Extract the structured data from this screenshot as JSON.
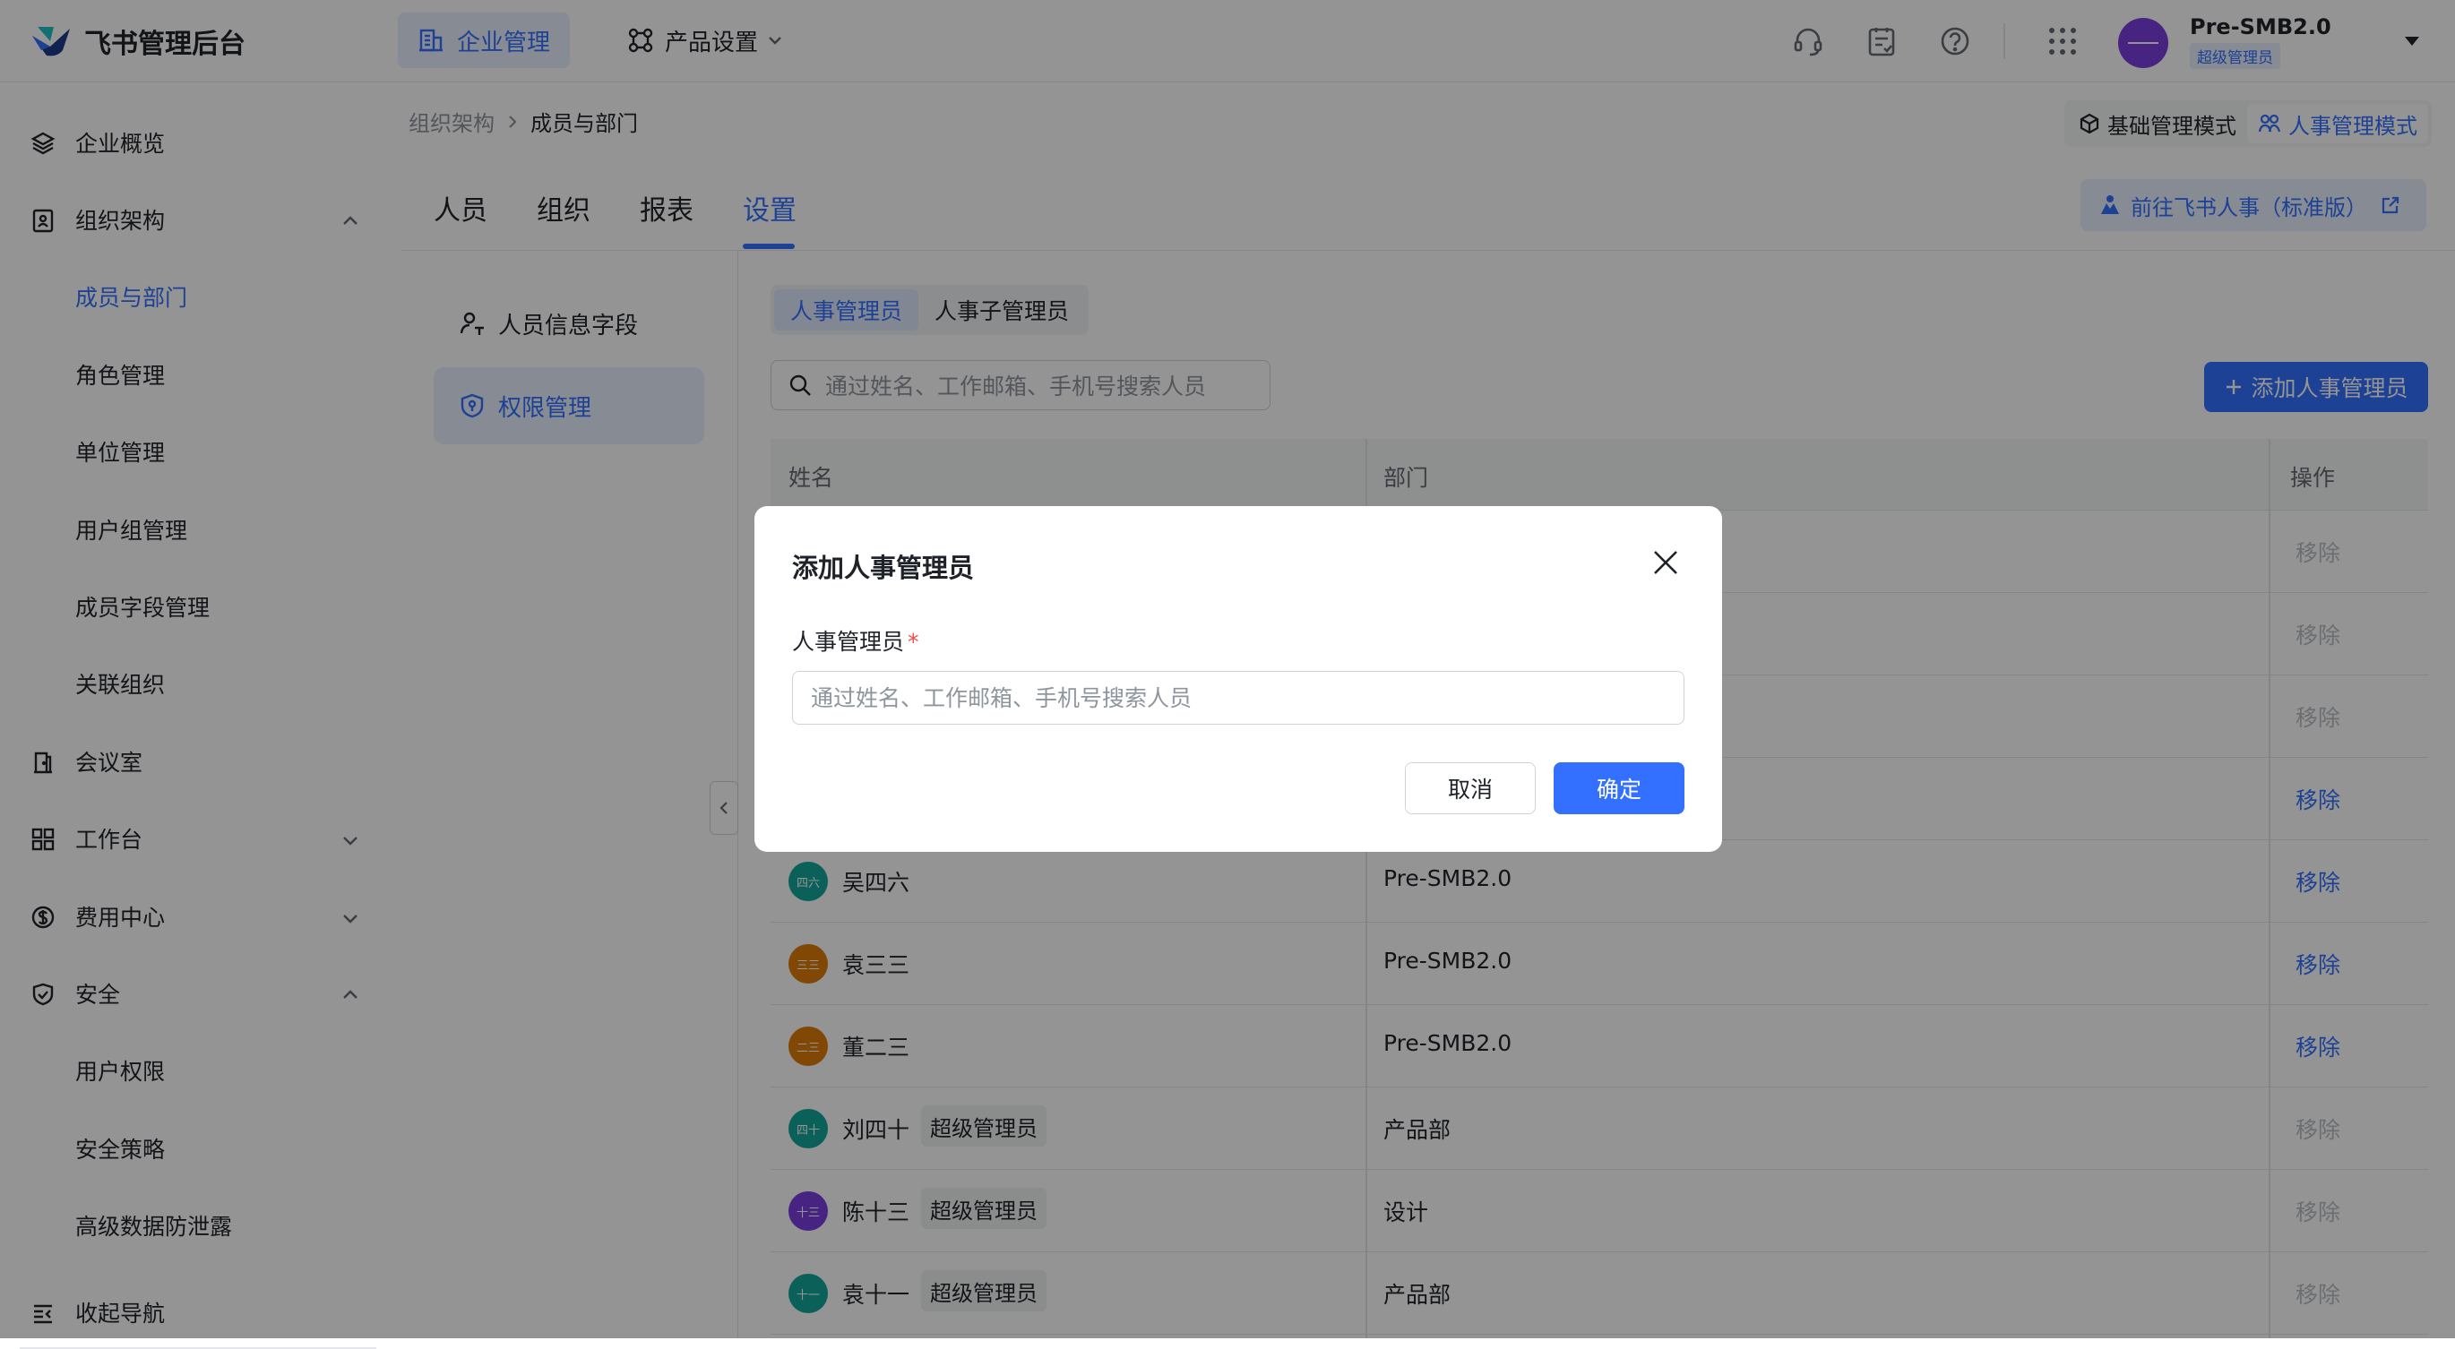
{
  "app": {
    "title": "飞书管理后台"
  },
  "topnav": {
    "enterprise": "企业管理",
    "product": "产品设置"
  },
  "user": {
    "name": "Pre-SMB2.0",
    "role": "超级管理员"
  },
  "sidebar": {
    "items": [
      {
        "label": "企业概览",
        "icon": "layers-icon"
      },
      {
        "label": "组织架构",
        "icon": "org-icon"
      },
      {
        "label": "成员与部门"
      },
      {
        "label": "角色管理"
      },
      {
        "label": "单位管理"
      },
      {
        "label": "用户组管理"
      },
      {
        "label": "成员字段管理"
      },
      {
        "label": "关联组织"
      },
      {
        "label": "会议室",
        "icon": "door-icon"
      },
      {
        "label": "工作台",
        "icon": "grid-icon"
      },
      {
        "label": "费用中心",
        "icon": "dollar-icon"
      },
      {
        "label": "安全",
        "icon": "shield-icon"
      },
      {
        "label": "用户权限"
      },
      {
        "label": "安全策略"
      },
      {
        "label": "高级数据防泄露"
      }
    ],
    "collapse": "收起导航"
  },
  "breadcrumb": {
    "parent": "组织架构",
    "current": "成员与部门"
  },
  "modes": {
    "basic": "基础管理模式",
    "hr": "人事管理模式"
  },
  "tabs": [
    "人员",
    "组织",
    "报表",
    "设置"
  ],
  "goto": "前往飞书人事（标准版）",
  "subnav": {
    "fields": "人员信息字段",
    "permissions": "权限管理"
  },
  "segment": {
    "hr_admin": "人事管理员",
    "hr_sub_admin": "人事子管理员"
  },
  "search": {
    "placeholder": "通过姓名、工作邮箱、手机号搜索人员"
  },
  "add_button": "添加人事管理员",
  "table": {
    "headers": {
      "name": "姓名",
      "dept": "部门",
      "action": "操作"
    },
    "rows": [
      {
        "action": "移除"
      },
      {
        "action": "移除"
      },
      {
        "action": "移除"
      },
      {
        "action": "移除"
      },
      {
        "avatar": "四六",
        "name": "吴四六",
        "dept": "Pre-SMB2.0",
        "action": "移除",
        "color": "#14a89a"
      },
      {
        "avatar": "三三",
        "name": "袁三三",
        "dept": "Pre-SMB2.0",
        "action": "移除",
        "color": "#de7a0a"
      },
      {
        "avatar": "二三",
        "name": "董二三",
        "dept": "Pre-SMB2.0",
        "action": "移除",
        "color": "#de7a0a"
      },
      {
        "avatar": "四十",
        "name": "刘四十",
        "tag": "超级管理员",
        "dept": "产品部",
        "action": "移除",
        "color": "#14a89a"
      },
      {
        "avatar": "十三",
        "name": "陈十三",
        "tag": "超级管理员",
        "dept": "设计",
        "action": "移除",
        "color": "#7a3fde"
      },
      {
        "avatar": "十一",
        "name": "袁十一",
        "tag": "超级管理员",
        "dept": "产品部",
        "action": "移除",
        "color": "#14a89a"
      }
    ]
  },
  "modal": {
    "title": "添加人事管理员",
    "field_label": "人事管理员",
    "required_mark": "*",
    "placeholder": "通过姓名、工作邮箱、手机号搜索人员",
    "cancel": "取消",
    "confirm": "确定"
  },
  "colors": {
    "accent": "#3370ff",
    "required": "#f54a45",
    "overlay": "rgba(0,0,0,0.42)"
  }
}
